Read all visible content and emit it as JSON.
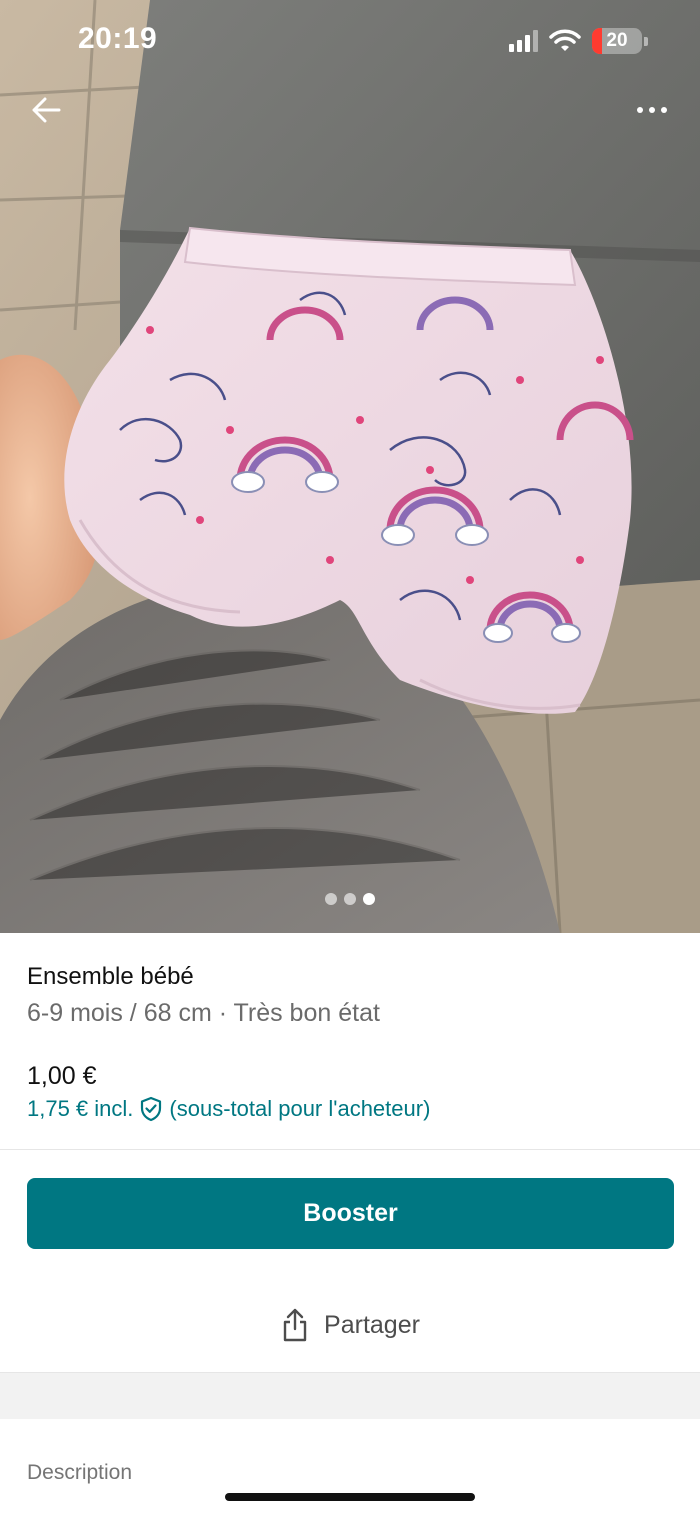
{
  "status_bar": {
    "time": "20:19",
    "battery_level": "20",
    "signal_bars": 3
  },
  "nav": {
    "back_icon": "arrow-left-icon",
    "more_icon": "ellipsis-icon"
  },
  "gallery": {
    "photo_count": 3,
    "active_index": 2
  },
  "item": {
    "title": "Ensemble bébé",
    "subtitle": "6-9 mois / 68 cm · Très bon état",
    "price": "1,00 €",
    "buyer_price": "1,75 € incl.",
    "buyer_price_note": "(sous-total pour l'acheteur)",
    "protection_icon": "shield-check-icon"
  },
  "actions": {
    "booster_label": "Booster",
    "share_label": "Partager",
    "share_icon": "share-icon"
  },
  "description": {
    "heading": "Description"
  },
  "colors": {
    "accent": "#007782",
    "text_primary": "#111111",
    "text_secondary": "#6b6b6b",
    "background": "#ffffff",
    "band": "#f2f2f2"
  }
}
